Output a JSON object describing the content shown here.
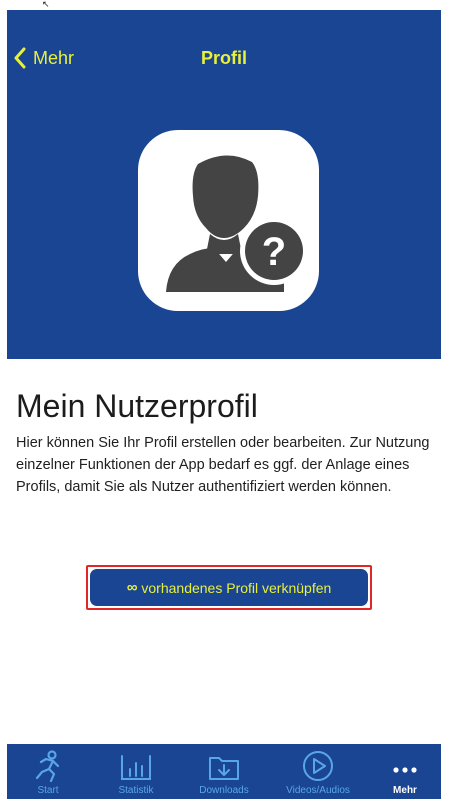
{
  "nav": {
    "back_label": "Mehr",
    "title": "Profil"
  },
  "content": {
    "heading": "Mein Nutzerprofil",
    "description": "Hier können Sie Ihr Profil erstellen oder bearbeiten. Zur Nutzung einzelner Funktionen der App bedarf es ggf. der Anlage eines Profils, damit Sie als Nutzer authentifiziert werden können.",
    "link_button": {
      "icon": "link-icon",
      "label": "vorhandenes Profil verknüpfen"
    }
  },
  "tabs": [
    {
      "label": "Start",
      "icon": "runner-icon",
      "active": false
    },
    {
      "label": "Statistik",
      "icon": "bar-chart-icon",
      "active": false
    },
    {
      "label": "Downloads",
      "icon": "download-folder-icon",
      "active": false
    },
    {
      "label": "Videos/Audios",
      "icon": "play-circle-icon",
      "active": false
    },
    {
      "label": "Mehr",
      "icon": "more-dots-icon",
      "active": true
    }
  ],
  "colors": {
    "primary": "#1a4592",
    "accent": "#e9f03a",
    "tab_inactive": "#58a6e8",
    "highlight": "#e02626"
  }
}
